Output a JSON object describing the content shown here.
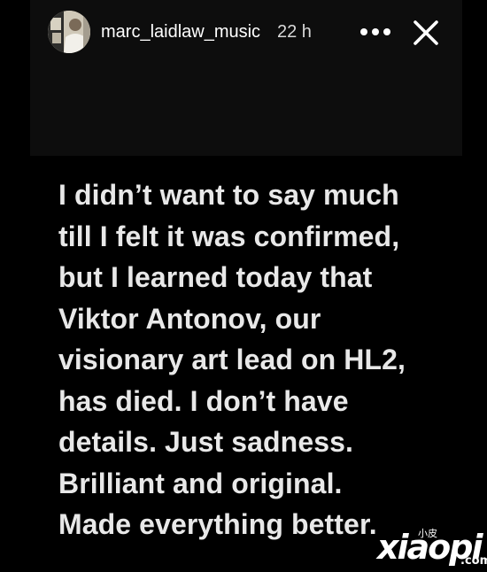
{
  "header": {
    "username": "marc_laidlaw_music",
    "time_ago": "22 h",
    "avatar": "profile-avatar",
    "icons": {
      "more": "more-horizontal-icon",
      "close": "close-icon"
    }
  },
  "story": {
    "lines": [
      "I didn’t want to say much",
      "till I felt it was confirmed,",
      "but I learned today that",
      "Viktor Antonov, our",
      "visionary art lead on HL2,",
      "has died. I don’t have",
      "details. Just sadness.",
      "Brilliant and original.",
      "Made everything better."
    ]
  },
  "watermark": {
    "small": "小皮",
    "brand": "xiaopi",
    "suffix": ".com"
  },
  "colors": {
    "background": "#000000",
    "header_background": "#0d0d0d",
    "text": "#e8e8e8"
  }
}
